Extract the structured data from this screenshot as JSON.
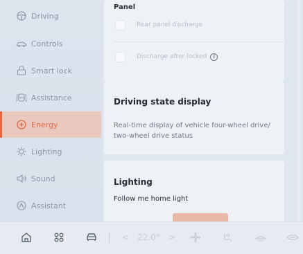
{
  "sidebar": {
    "items": [
      {
        "label": "Driving",
        "icon": "steering-wheel-icon",
        "active": false
      },
      {
        "label": "Controls",
        "icon": "car-controls-icon",
        "active": false
      },
      {
        "label": "Smart lock",
        "icon": "lock-icon",
        "active": false
      },
      {
        "label": "Assistance",
        "icon": "lane-assist-icon",
        "active": false
      },
      {
        "label": "Energy",
        "icon": "energy-icon",
        "active": true
      },
      {
        "label": "Lighting",
        "icon": "light-bulb-icon",
        "active": false
      },
      {
        "label": "Sound",
        "icon": "speaker-icon",
        "active": false
      },
      {
        "label": "Assistant",
        "icon": "assistant-icon",
        "active": false
      }
    ]
  },
  "panel": {
    "title": "Panel",
    "rear_discharge_label": "Rear panel discharge",
    "discharge_locked_label": "Discharge after locked",
    "info_glyph": "i"
  },
  "driving_state": {
    "title": "Driving state display",
    "description": "Real-time display of vehicle four-wheel drive/ two-wheel drive status"
  },
  "lighting": {
    "title": "Lighting",
    "subtitle": "Follow me home light"
  },
  "bottombar": {
    "temp_left_arrow": "<",
    "temperature": "22.0°",
    "temp_right_arrow": ">",
    "icons": [
      "home-icon",
      "apps-grid-icon",
      "car-icon",
      "fan-icon",
      "seat-heat-icon",
      "defrost-icon",
      "vent-icon"
    ]
  },
  "colors": {
    "accent": "#e86a45",
    "active_bg": "#ebc8bd",
    "card_bg": "#eef2f7",
    "sidebar_bg": "#dde4ee"
  }
}
